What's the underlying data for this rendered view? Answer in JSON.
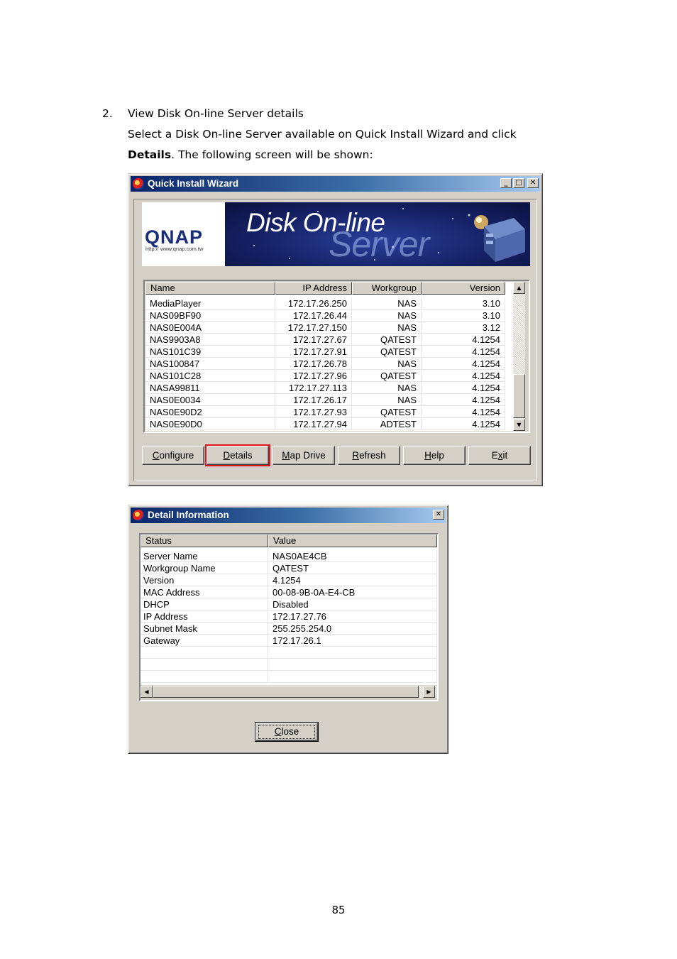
{
  "document": {
    "step_number": "2.",
    "step_title": "View Disk On-line Server details",
    "step_description_line1": "Select a Disk On-line Server available on Quick Install Wizard and click",
    "step_description_bold": "Details",
    "step_description_rest": ".  The following screen will be shown:",
    "page_number": "85"
  },
  "wizard": {
    "title": "Quick Install Wizard",
    "banner": {
      "logo_text": "QNAP",
      "logo_url": "http:// www.qnap.com.tw",
      "product_line1": "Disk On-line",
      "product_line2": "Server"
    },
    "columns": [
      "Name",
      "IP Address",
      "Workgroup",
      "Version"
    ],
    "rows": [
      [
        "MediaPlayer",
        "172.17.26.250",
        "NAS",
        "3.10"
      ],
      [
        "NAS09BF90",
        "172.17.26.44",
        "NAS",
        "3.10"
      ],
      [
        "NAS0E004A",
        "172.17.27.150",
        "NAS",
        "3.12"
      ],
      [
        "NAS9903A8",
        "172.17.27.67",
        "QATEST",
        "4.1254"
      ],
      [
        "NAS101C39",
        "172.17.27.91",
        "QATEST",
        "4.1254"
      ],
      [
        "NAS100847",
        "172.17.26.78",
        "NAS",
        "4.1254"
      ],
      [
        "NAS101C28",
        "172.17.27.96",
        "QATEST",
        "4.1254"
      ],
      [
        "NASA99811",
        "172.17.27.113",
        "NAS",
        "4.1254"
      ],
      [
        "NAS0E0034",
        "172.17.26.17",
        "NAS",
        "4.1254"
      ],
      [
        "NAS0E90D2",
        "172.17.27.93",
        "QATEST",
        "4.1254"
      ],
      [
        "NAS0E90D0",
        "172.17.27.94",
        "ADTEST",
        "4.1254"
      ]
    ],
    "buttons": {
      "configure": {
        "mn": "C",
        "rest": "onfigure"
      },
      "details": {
        "mn": "D",
        "rest": "etails"
      },
      "map_drive": {
        "mn": "M",
        "rest": "ap Drive"
      },
      "refresh": {
        "mn": "R",
        "rest": "efresh"
      },
      "help": {
        "mn": "H",
        "rest": "elp"
      },
      "exit": {
        "pre": "E",
        "mn": "x",
        "rest": "it"
      }
    },
    "highlight_color": "#e0141c"
  },
  "detail": {
    "title": "Detail Information",
    "columns": [
      "Status",
      "Value"
    ],
    "rows": [
      [
        "Server Name",
        "NAS0AE4CB"
      ],
      [
        "Workgroup Name",
        "QATEST"
      ],
      [
        "Version",
        "4.1254"
      ],
      [
        "MAC Address",
        "00-08-9B-0A-E4-CB"
      ],
      [
        "DHCP",
        "Disabled"
      ],
      [
        "IP Address",
        "172.17.27.76"
      ],
      [
        "Subnet Mask",
        "255.255.254.0"
      ],
      [
        "Gateway",
        "172.17.26.1"
      ]
    ],
    "close_button": {
      "mn": "C",
      "rest": "lose"
    }
  },
  "colors": {
    "titlebar_start": "#0a246a",
    "titlebar_end": "#a6caf0",
    "window_face": "#d4d0c8"
  }
}
